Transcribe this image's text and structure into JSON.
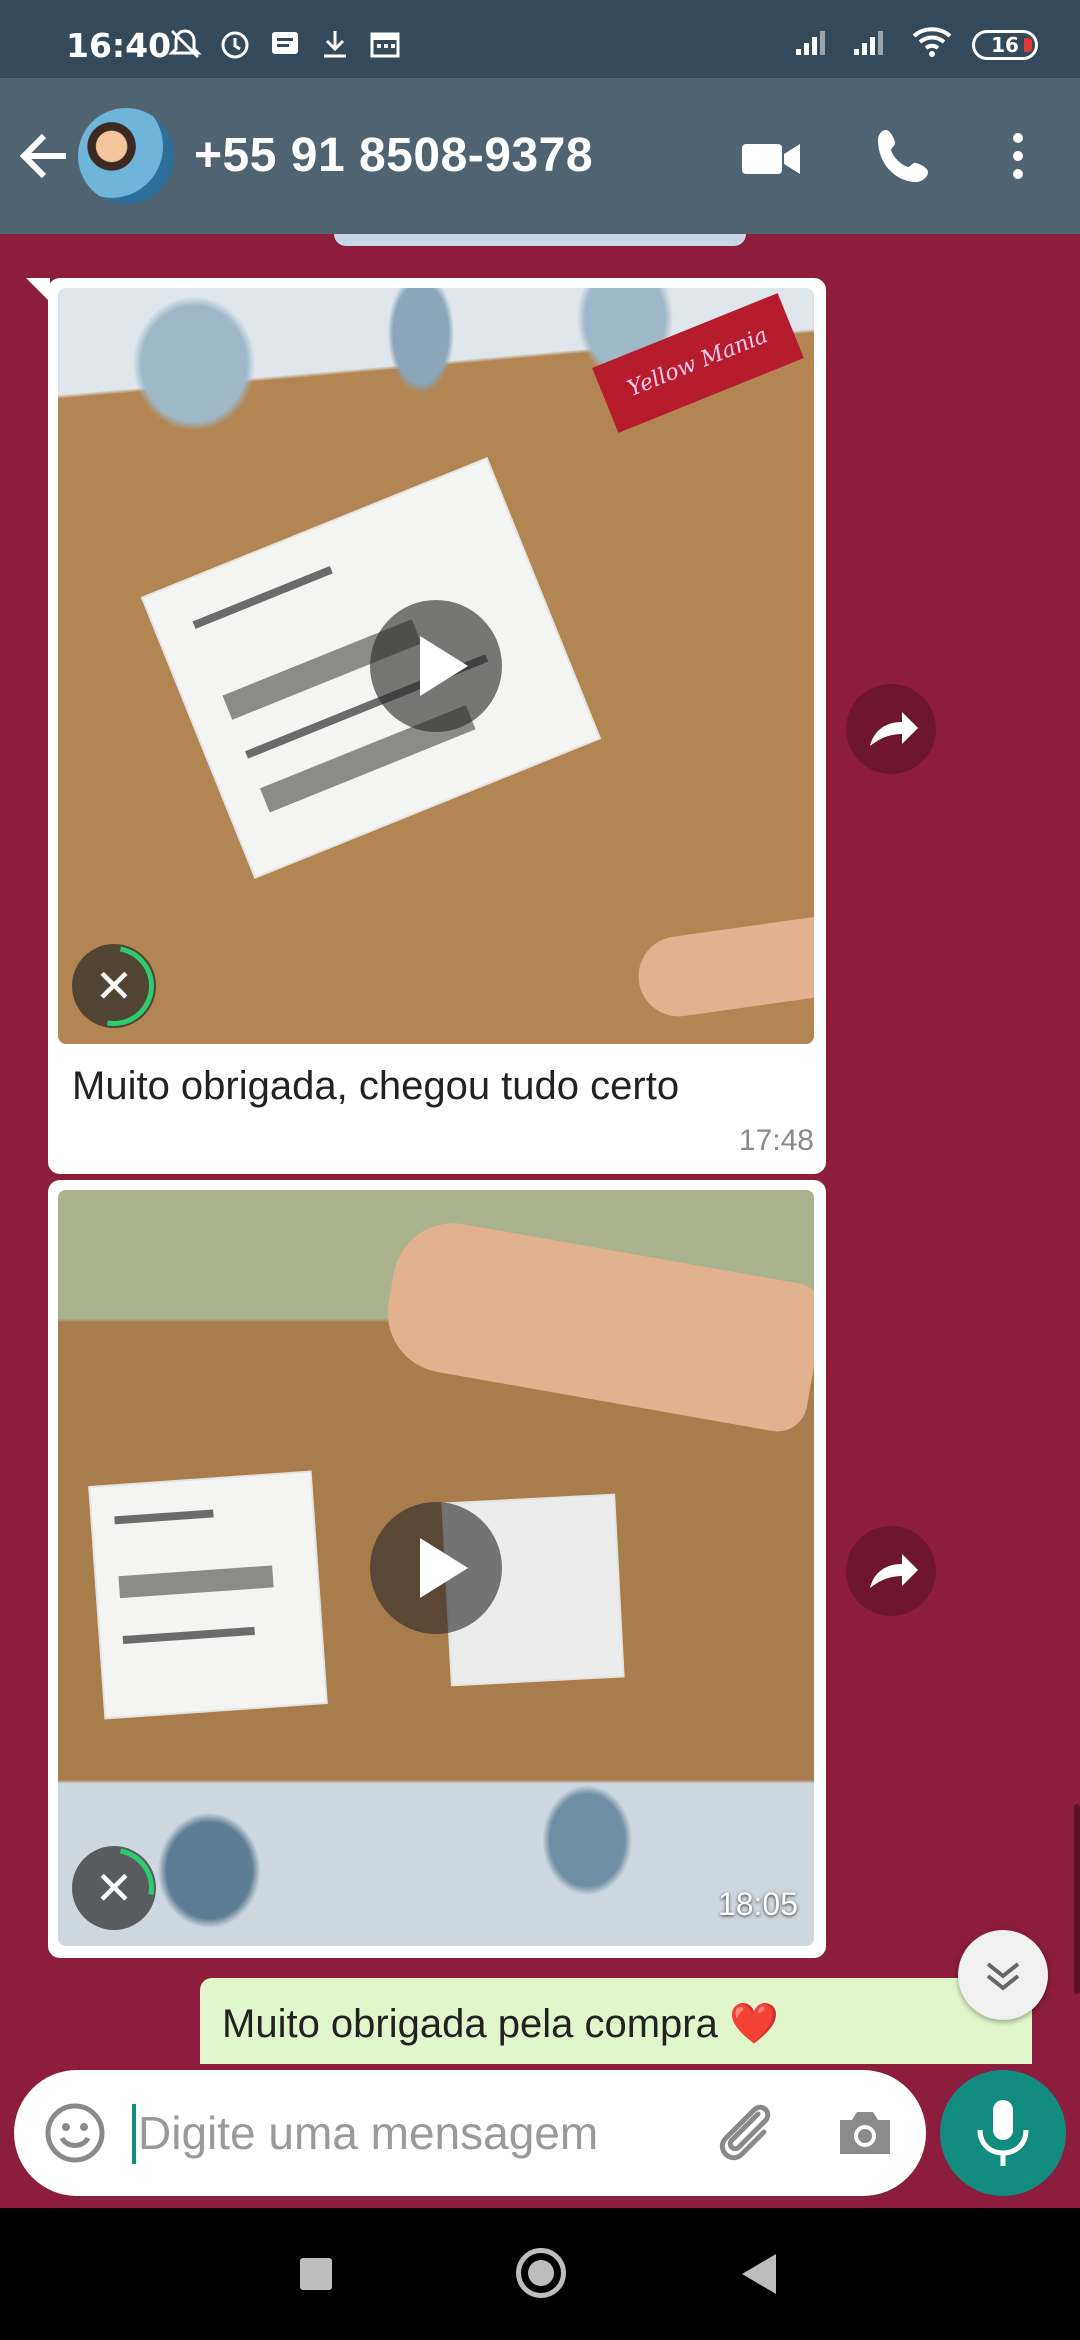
{
  "status_bar": {
    "time": "16:40",
    "battery": "16",
    "icons": [
      "bell-muted-icon",
      "alarm-icon",
      "message-icon",
      "download-icon",
      "calendar-icon",
      "signal-icon",
      "signal-icon",
      "wifi-icon",
      "battery-icon"
    ],
    "battery_level_percent": 16
  },
  "header": {
    "contact_name": "+55 91 8508-9378",
    "icons": {
      "back": "arrow-left-icon",
      "video": "video-camera-icon",
      "call": "phone-icon",
      "menu": "more-vertical-icon"
    }
  },
  "messages": [
    {
      "kind": "video",
      "caption": "Muito obrigada, chegou tudo certo",
      "time": "17:48",
      "label_text": "Yellow Mania"
    },
    {
      "kind": "video",
      "time": "18:05"
    },
    {
      "kind": "text",
      "direction": "outgoing",
      "text": "Muito obrigada pela compra",
      "emoji": "❤️"
    }
  ],
  "input": {
    "placeholder": "Digite uma mensagem",
    "value": ""
  },
  "colors": {
    "chat_background": "#8c1d3c",
    "header": "#4f6470",
    "status_bar": "#34495a",
    "outgoing_bubble": "#e1f7cb",
    "accent": "#128c7e",
    "progress": "#2ecc71"
  }
}
